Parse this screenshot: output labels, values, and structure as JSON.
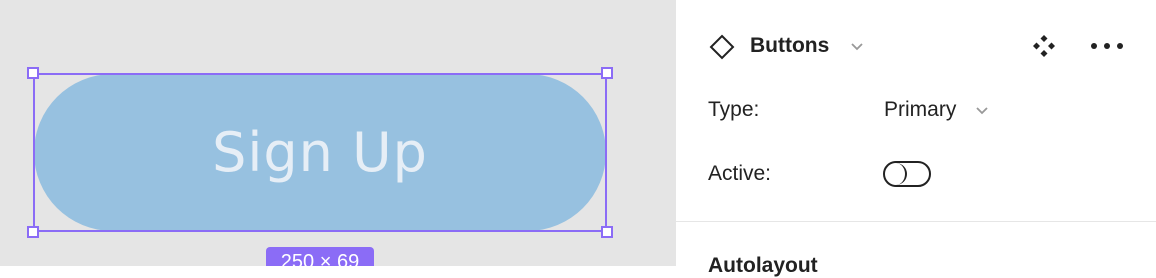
{
  "canvas": {
    "button_label": "Sign Up",
    "size_badge": "250 × 69",
    "button_color": "#97c1e0",
    "selection_color": "#8b6cf6"
  },
  "panel": {
    "component_name": "Buttons",
    "component_icon": "component-diamond-icon",
    "type_label": "Type:",
    "type_value": "Primary",
    "active_label": "Active:",
    "active_value": false,
    "next_section_heading": "Autolayout"
  }
}
